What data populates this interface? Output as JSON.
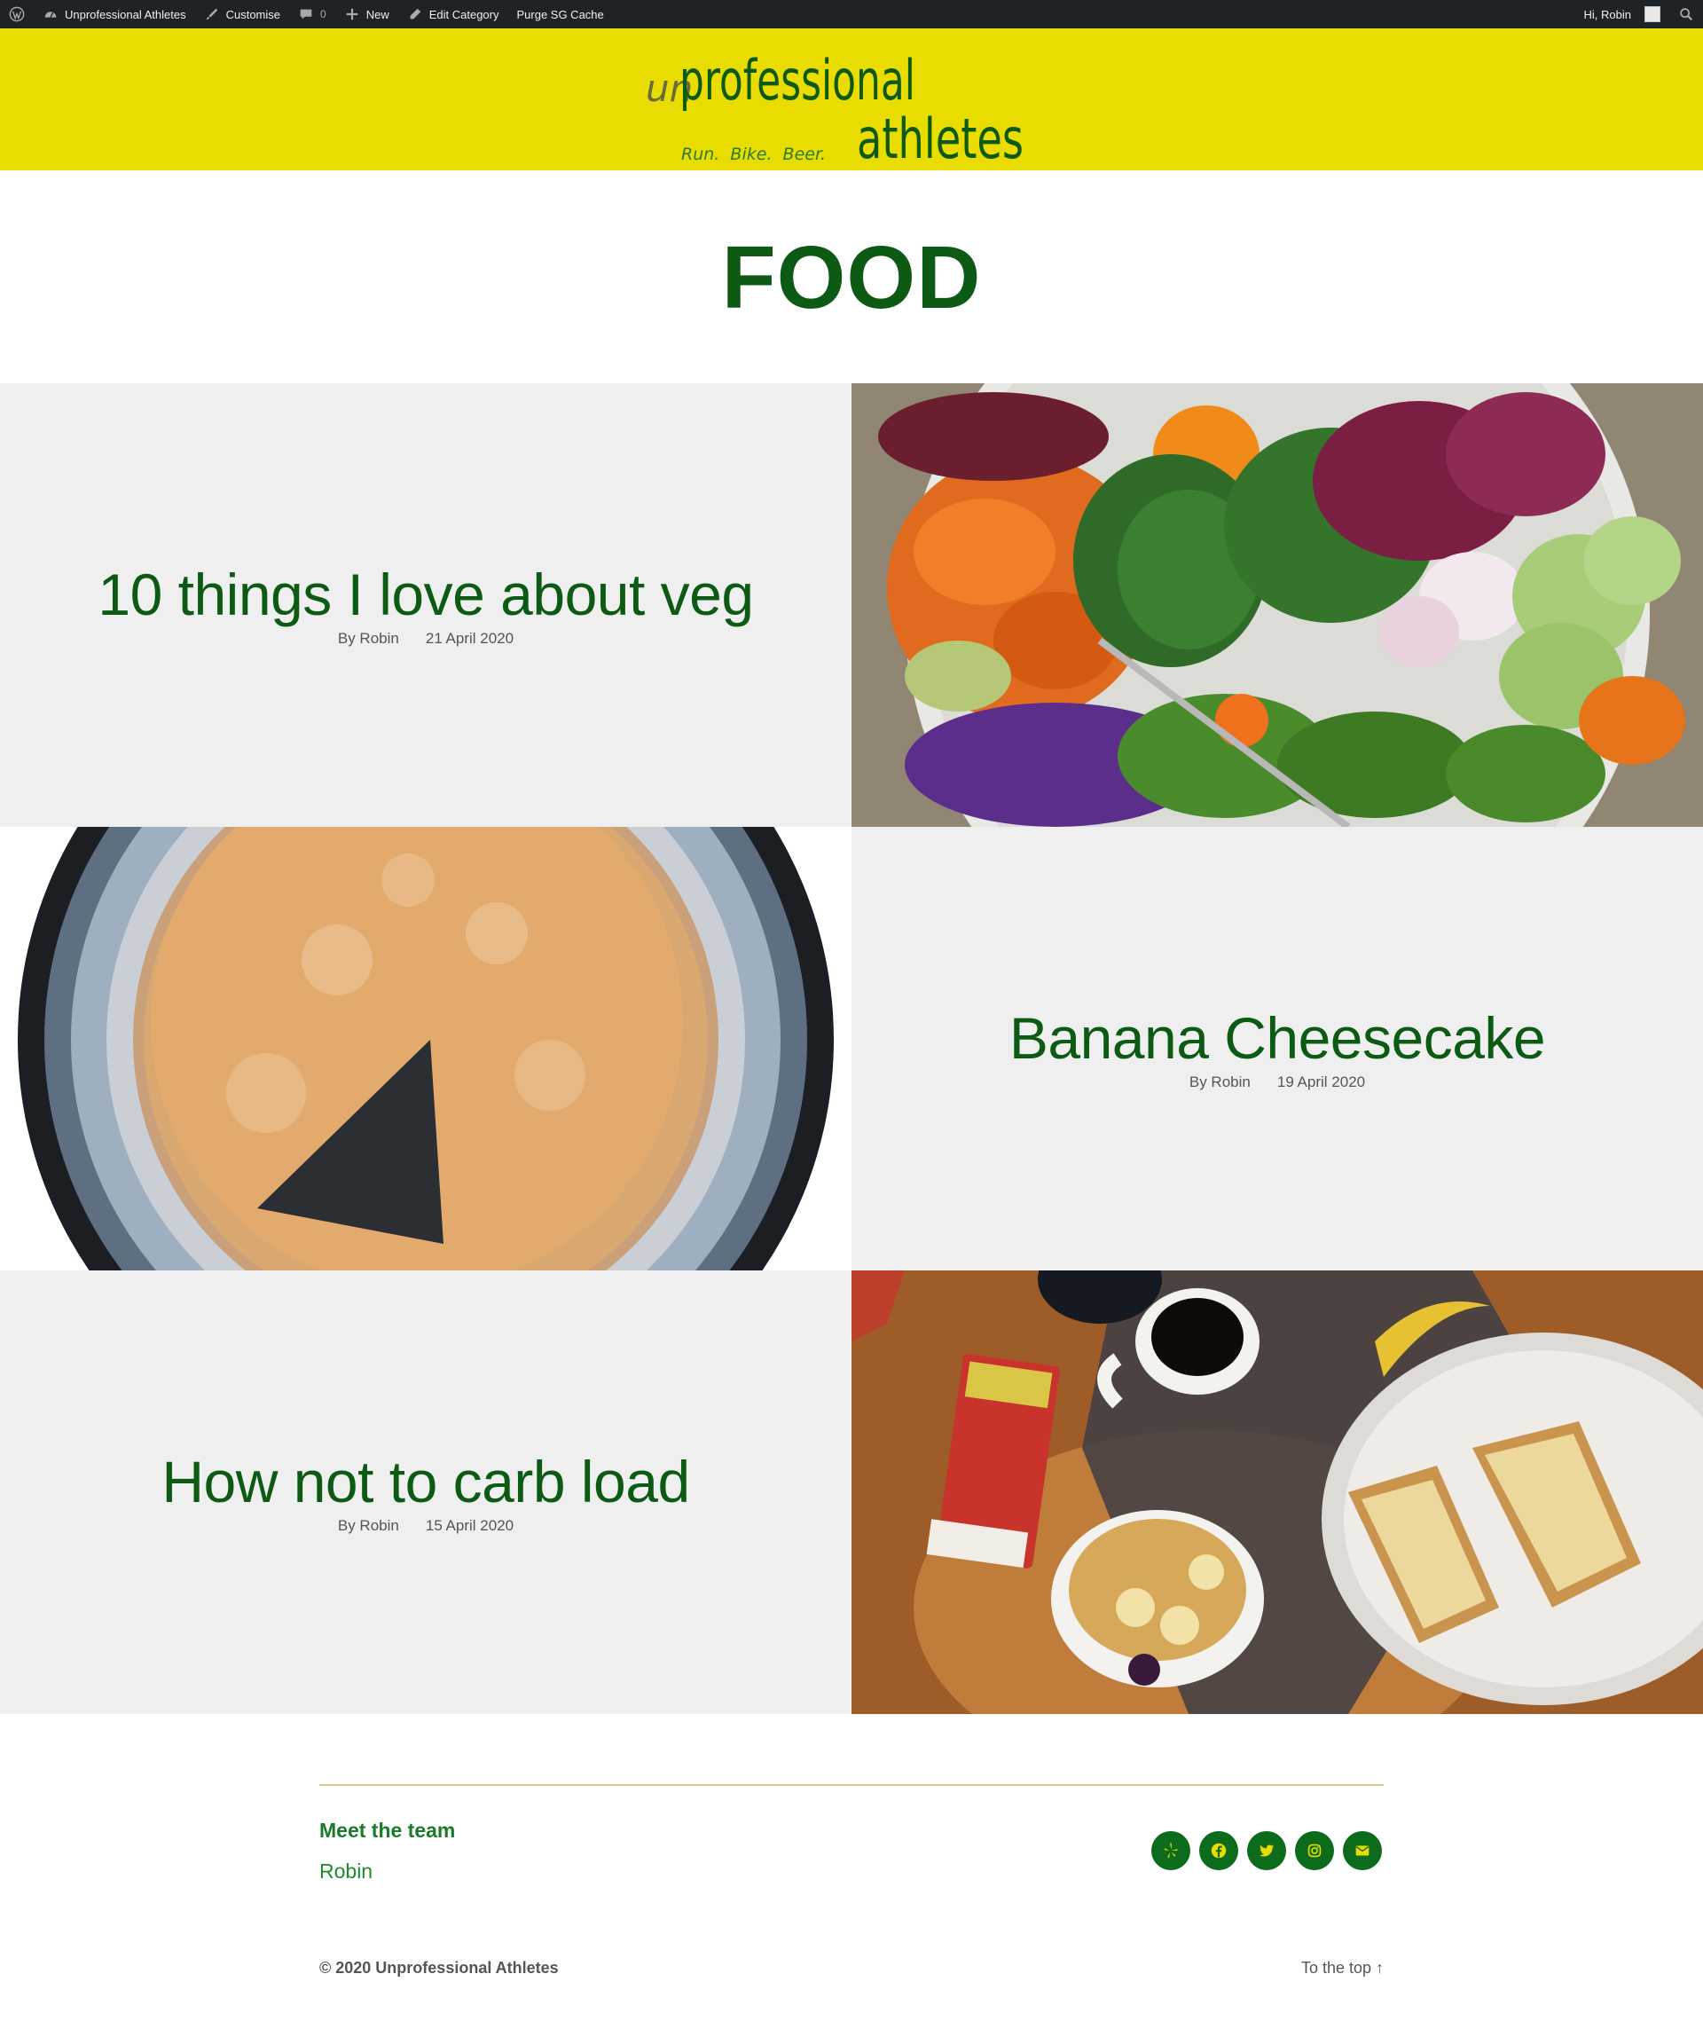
{
  "adminbar": {
    "site_name": "Unprofessional Athletes",
    "customise": "Customise",
    "comments_count": "0",
    "new": "New",
    "edit_category": "Edit Category",
    "purge_cache": "Purge SG Cache",
    "greeting": "Hi, Robin"
  },
  "header": {
    "logo_prefix": "un",
    "logo_word1": "professional",
    "logo_word2": "athletes",
    "tagline": "Run.  Bike.  Beer."
  },
  "archive": {
    "title": "FOOD"
  },
  "posts": [
    {
      "title": "10 things I love about veg",
      "author": "By Robin",
      "date": "21 April 2020",
      "image": "salad-bowl"
    },
    {
      "title": "Banana Cheesecake",
      "author": "By Robin",
      "date": "19 April 2020",
      "image": "cheesecake"
    },
    {
      "title": "How not to carb load",
      "author": "By Robin",
      "date": "15 April 2020",
      "image": "breakfast-table"
    }
  ],
  "footer": {
    "team_heading": "Meet the team",
    "team_member": "Robin",
    "socials": [
      "yelp-icon",
      "facebook-icon",
      "twitter-icon",
      "instagram-icon",
      "mail-icon"
    ],
    "copyright": "© 2020 Unprofessional Athletes",
    "to_top": "To the top ↑"
  },
  "colors": {
    "header_yellow": "#e9dc00",
    "brand_green": "#0d5a14",
    "admin_bar": "#1d2327",
    "post_bg": "#efefef"
  }
}
